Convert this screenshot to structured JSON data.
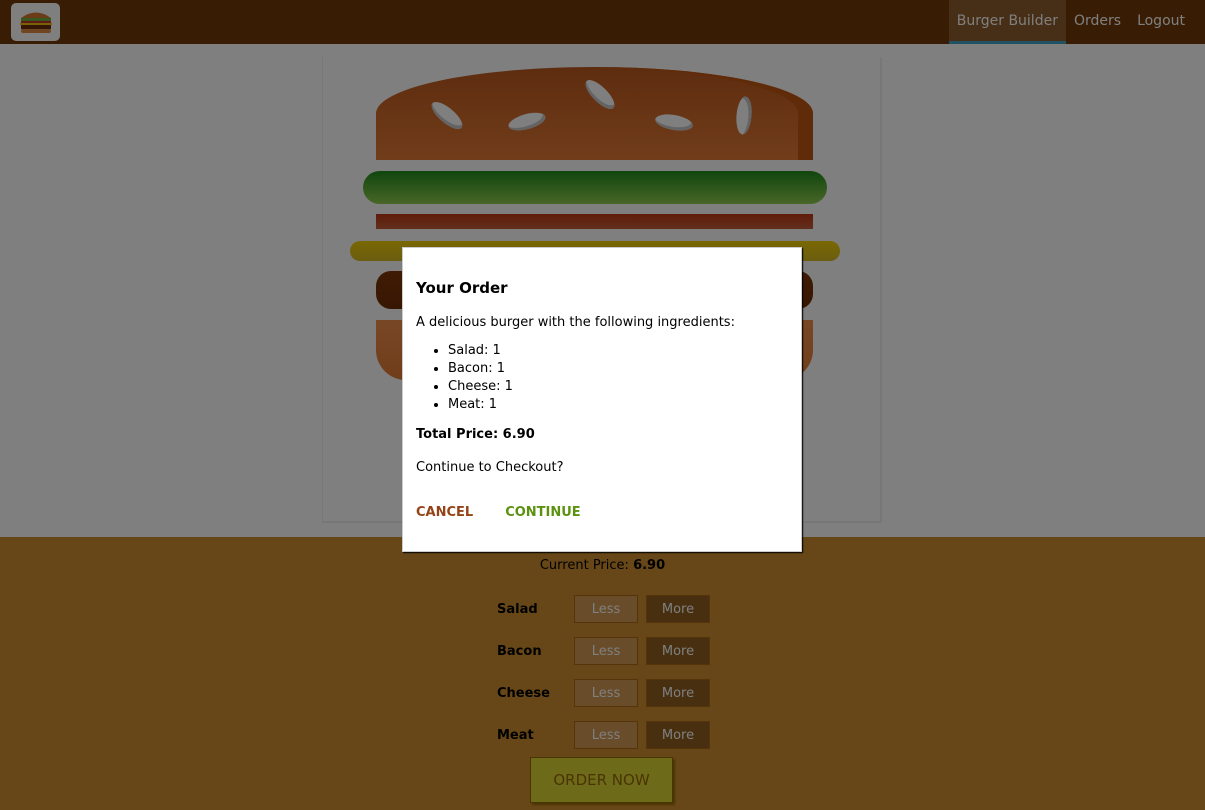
{
  "toolbar": {
    "logo_icon": "burger-logo",
    "nav": [
      {
        "label": "Burger Builder",
        "active": true
      },
      {
        "label": "Orders",
        "active": false
      },
      {
        "label": "Logout",
        "active": false
      }
    ]
  },
  "burger": {
    "layers": [
      "bread-top",
      "salad",
      "bacon",
      "cheese",
      "meat",
      "bread-bottom"
    ]
  },
  "build_controls": {
    "price_label": "Current Price:",
    "price_value": "6.90",
    "controls": [
      {
        "label": "Salad",
        "less": "Less",
        "more": "More"
      },
      {
        "label": "Bacon",
        "less": "Less",
        "more": "More"
      },
      {
        "label": "Cheese",
        "less": "Less",
        "more": "More"
      },
      {
        "label": "Meat",
        "less": "Less",
        "more": "More"
      }
    ],
    "order_button": "ORDER NOW"
  },
  "modal": {
    "title": "Your Order",
    "intro": "A delicious burger with the following ingredients:",
    "ingredients": [
      "Salad: 1",
      "Bacon: 1",
      "Cheese: 1",
      "Meat: 1"
    ],
    "total_label": "Total Price: 6.90",
    "question": "Continue to Checkout?",
    "cancel": "CANCEL",
    "continue": "CONTINUE"
  },
  "colors": {
    "toolbar": "#703b09",
    "build_controls": "#cf8f2e",
    "cancel": "#944317",
    "continue": "#5c9210"
  }
}
